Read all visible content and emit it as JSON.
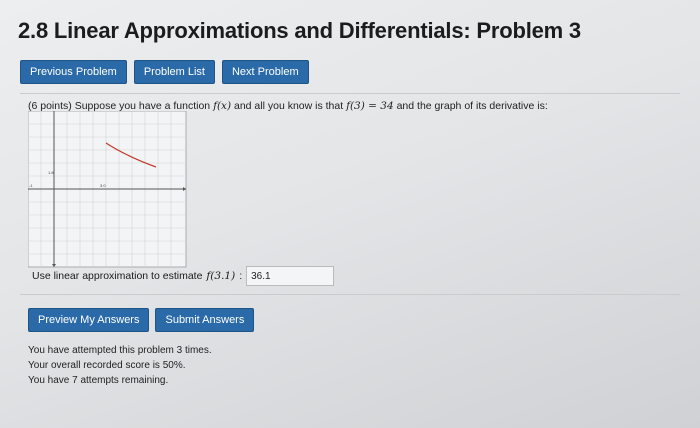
{
  "page": {
    "title": "2.8 Linear Approximations and Differentials: Problem 3"
  },
  "nav": {
    "previous_label": "Previous Problem",
    "list_label": "Problem List",
    "next_label": "Next Problem"
  },
  "problem": {
    "points": "(6 points)",
    "text_1": "Suppose you have a function",
    "fx": "f(x)",
    "text_2": "and all you know is that",
    "f3": "f(3) = 34",
    "text_3": "and the graph of its derivative is:",
    "graph": {
      "y_tick_label": "1.8",
      "x_tick_label": "3.0",
      "x_axis_left_label": "-1"
    },
    "answer_prompt": "Use linear approximation to estimate",
    "answer_fx": "f(3.1)",
    "answer_colon": ":",
    "answer_value": "36.1"
  },
  "actions": {
    "preview_label": "Preview My Answers",
    "submit_label": "Submit Answers"
  },
  "status": {
    "line1": "You have attempted this problem 3 times.",
    "line2": "Your overall recorded score is 50%.",
    "line3": "You have 7 attempts remaining."
  },
  "colors": {
    "button": "#2a6aa8",
    "curve": "#c0392b"
  }
}
